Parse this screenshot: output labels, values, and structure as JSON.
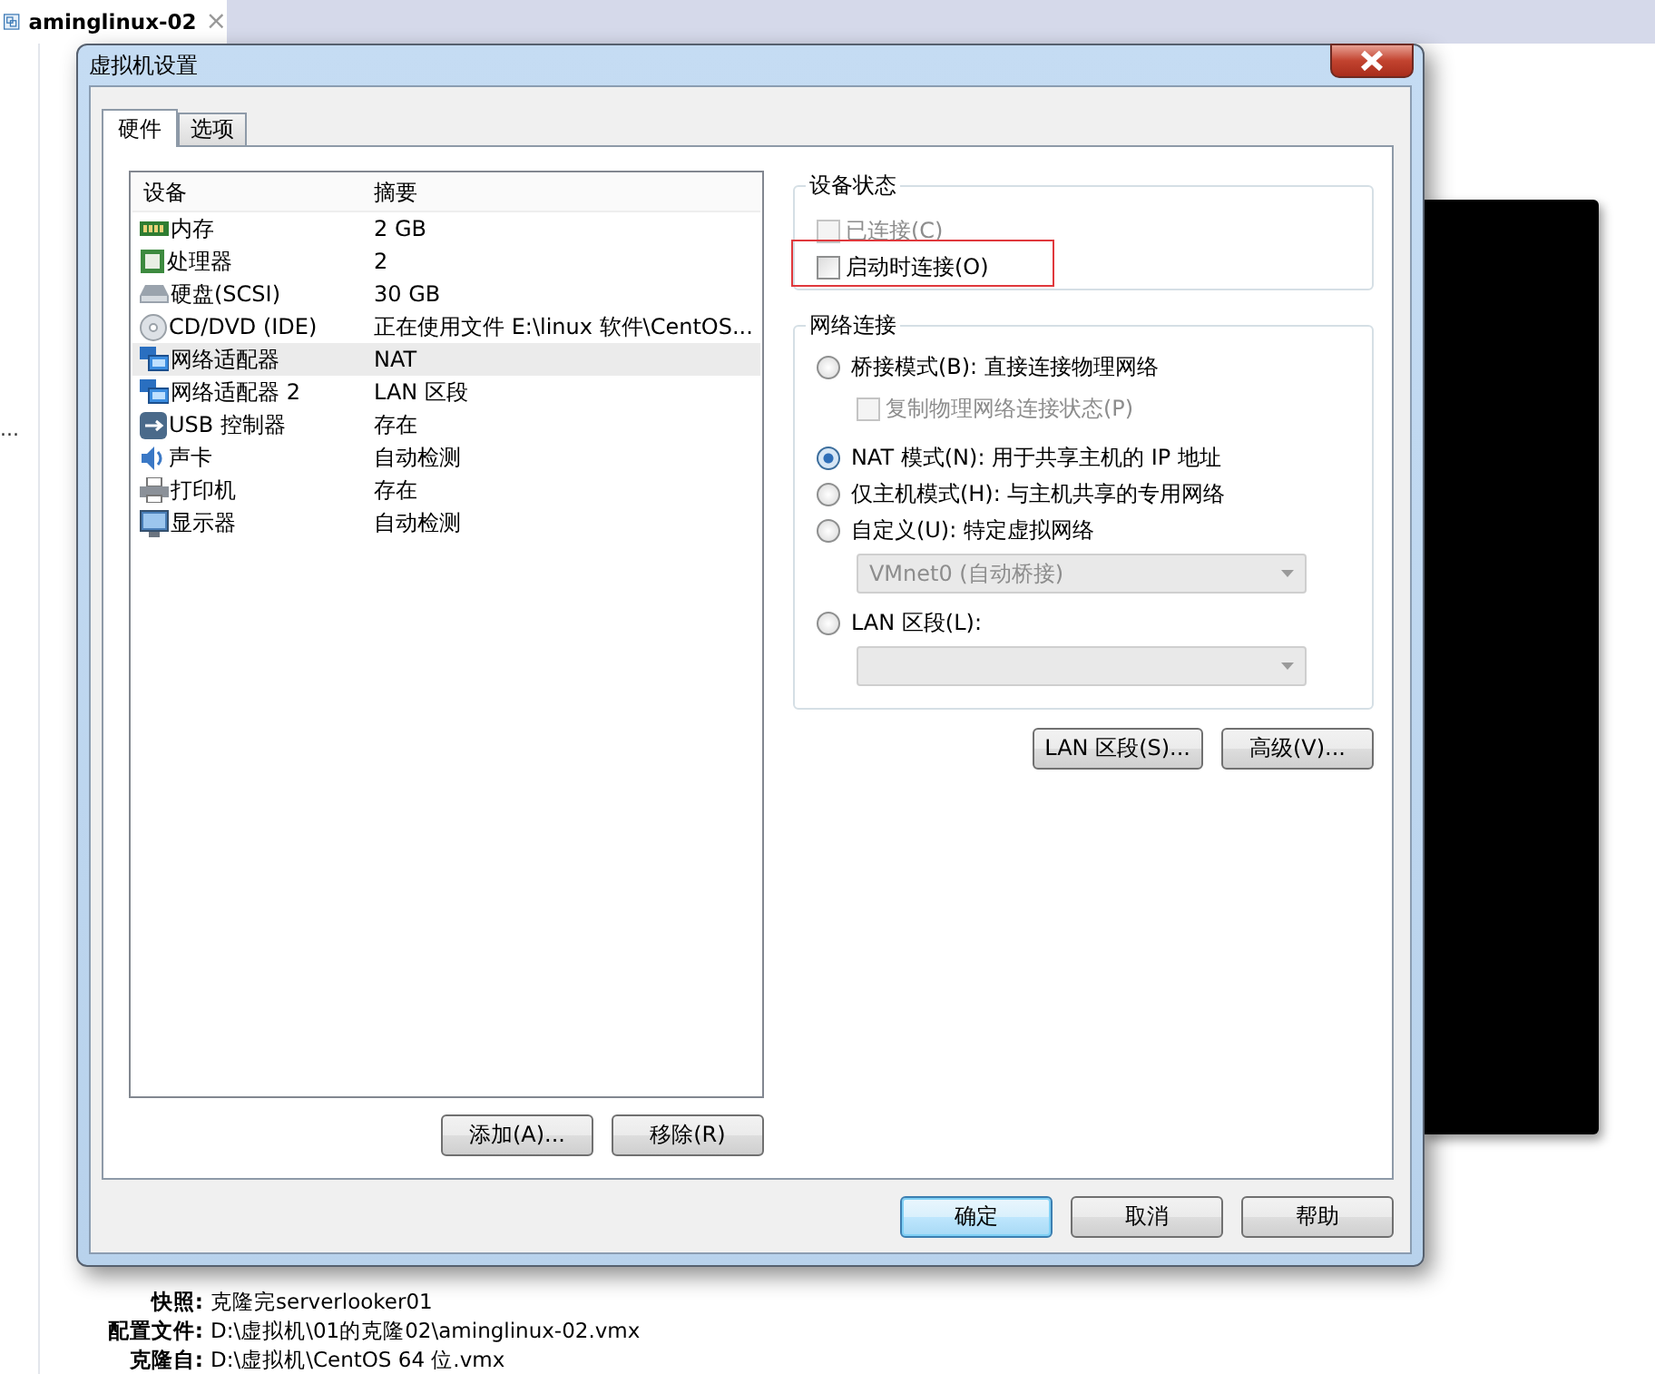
{
  "background_window": {
    "tab": {
      "title": "aminglinux-02",
      "close": "×"
    },
    "sidebar_text": "...",
    "details": [
      {
        "label": "快照:",
        "value": "克隆完serverlooker01"
      },
      {
        "label": "配置文件:",
        "value": "D:\\虚拟机\\01的克隆02\\aminglinux-02.vmx"
      },
      {
        "label": "克隆自:",
        "value": "D:\\虚拟机\\CentOS 64 位.vmx"
      }
    ]
  },
  "dialog": {
    "title": "虚拟机设置",
    "tabs": [
      {
        "label": "硬件",
        "selected": true
      },
      {
        "label": "选项",
        "selected": false
      }
    ],
    "device_table": {
      "columns": [
        "设备",
        "摘要"
      ],
      "rows": [
        {
          "kind": "memory",
          "device": "内存",
          "summary": "2 GB",
          "selected": false
        },
        {
          "kind": "cpu",
          "device": "处理器",
          "summary": "2",
          "selected": false
        },
        {
          "kind": "disk",
          "device": "硬盘(SCSI)",
          "summary": "30 GB",
          "selected": false
        },
        {
          "kind": "cd",
          "device": "CD/DVD (IDE)",
          "summary": "正在使用文件 E:\\linux 软件\\CentOS...",
          "selected": false
        },
        {
          "kind": "network",
          "device": "网络适配器",
          "summary": "NAT",
          "selected": true
        },
        {
          "kind": "network",
          "device": "网络适配器 2",
          "summary": "LAN 区段",
          "selected": false
        },
        {
          "kind": "usb",
          "device": "USB 控制器",
          "summary": "存在",
          "selected": false
        },
        {
          "kind": "sound",
          "device": "声卡",
          "summary": "自动检测",
          "selected": false
        },
        {
          "kind": "printer",
          "device": "打印机",
          "summary": "存在",
          "selected": false
        },
        {
          "kind": "display",
          "device": "显示器",
          "summary": "自动检测",
          "selected": false
        }
      ]
    },
    "table_buttons": [
      "添加(A)...",
      "移除(R)"
    ],
    "device_status": {
      "title": "设备状态",
      "items": [
        {
          "label": "已连接(C)",
          "checked": false,
          "disabled": true,
          "highlighted": false
        },
        {
          "label": "启动时连接(O)",
          "checked": false,
          "disabled": false,
          "highlighted": true
        }
      ]
    },
    "network": {
      "title": "网络连接",
      "options": [
        {
          "kind": "radio",
          "label": "桥接模式(B): 直接连接物理网络",
          "selected": false
        },
        {
          "kind": "checkbox",
          "label": "复制物理网络连接状态(P)",
          "checked": false,
          "disabled": true
        },
        {
          "kind": "radio",
          "label": "NAT 模式(N): 用于共享主机的 IP 地址",
          "selected": true
        },
        {
          "kind": "radio",
          "label": "仅主机模式(H): 与主机共享的专用网络",
          "selected": false
        },
        {
          "kind": "radio",
          "label": "自定义(U): 特定虚拟网络",
          "selected": false
        },
        {
          "kind": "dropdown",
          "value": "VMnet0 (自动桥接)",
          "disabled": true
        },
        {
          "kind": "radio",
          "label": "LAN 区段(L):",
          "selected": false
        },
        {
          "kind": "dropdown",
          "disabled": true
        }
      ]
    },
    "network_buttons": [
      "LAN 区段(S)...",
      "高级(V)..."
    ],
    "footer_buttons": [
      {
        "label": "确定",
        "default": true
      },
      {
        "label": "取消",
        "default": false
      },
      {
        "label": "帮助",
        "default": false
      }
    ]
  }
}
